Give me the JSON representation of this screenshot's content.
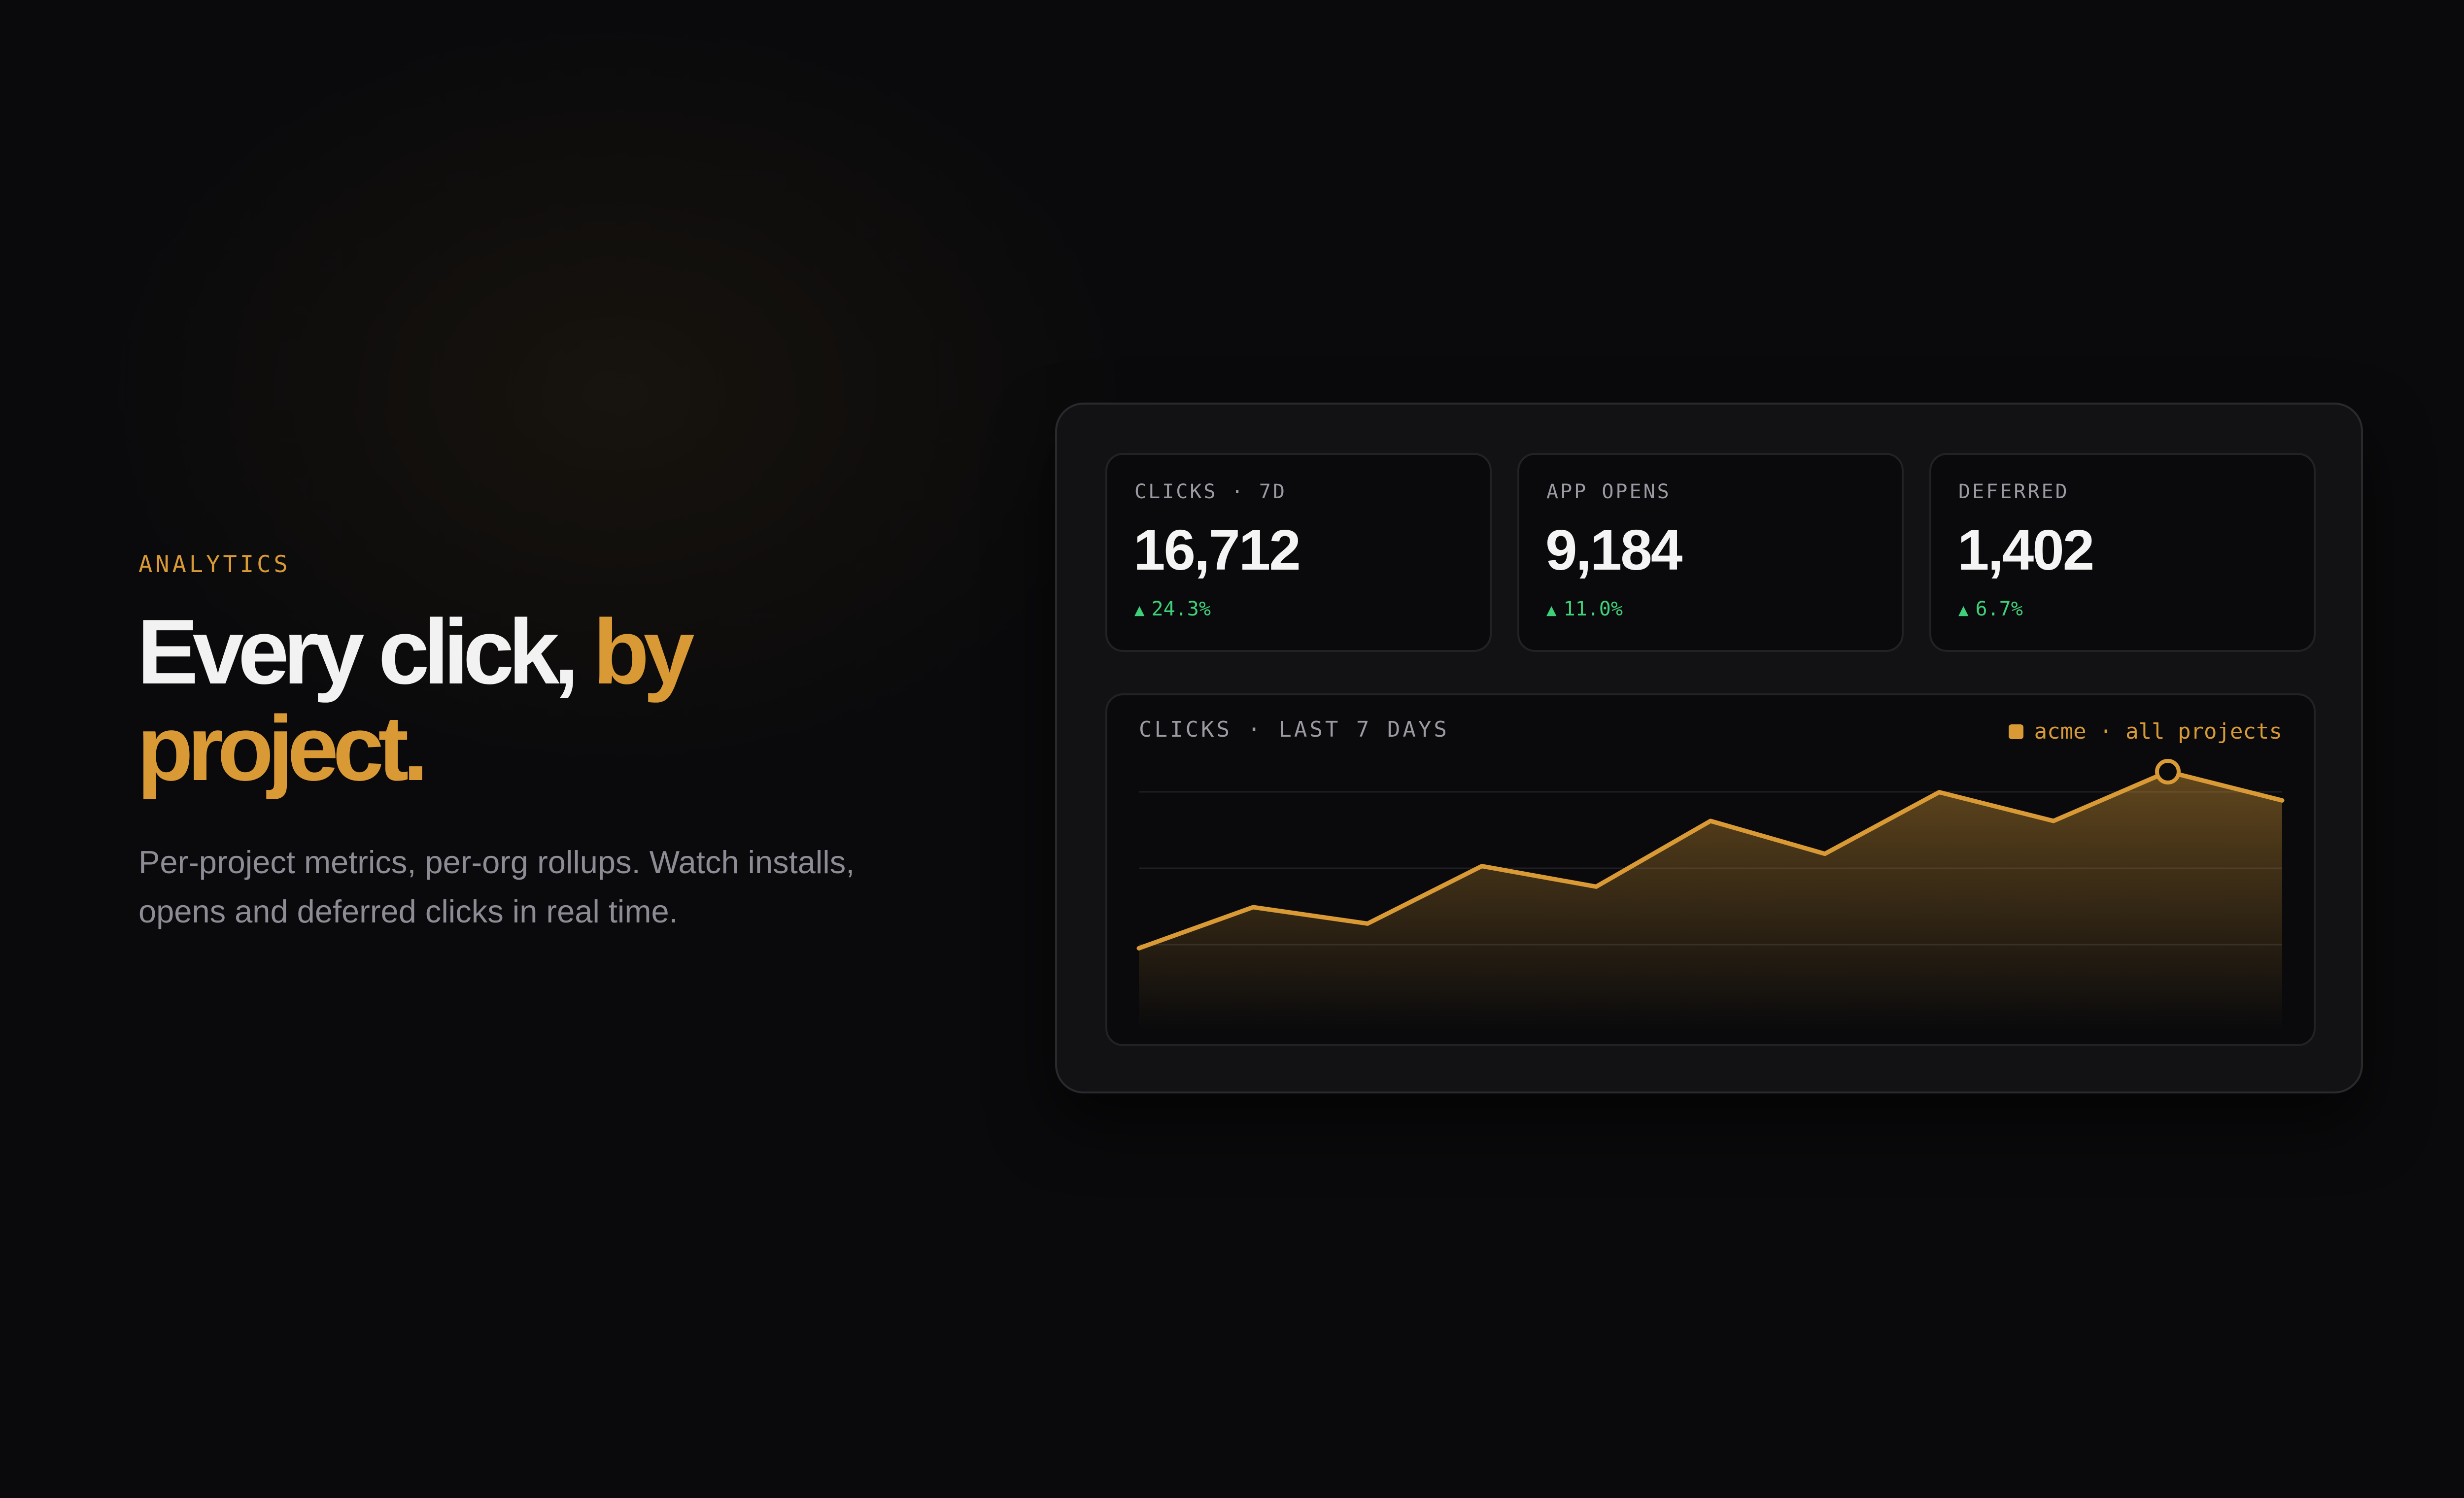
{
  "hero": {
    "eyebrow": "ANALYTICS",
    "headline_main": "Every click,",
    "headline_accent": "by project.",
    "subtitle": "Per-project metrics, per-org rollups. Watch installs, opens and deferred clicks in real time."
  },
  "stats": [
    {
      "label": "CLICKS · 7D",
      "value": "16,712",
      "delta": "24.3%",
      "trend_icon": "triangle-up-icon"
    },
    {
      "label": "APP OPENS",
      "value": "9,184",
      "delta": "11.0%",
      "trend_icon": "triangle-up-icon"
    },
    {
      "label": "DEFERRED",
      "value": "1,402",
      "delta": "6.7%",
      "trend_icon": "triangle-up-icon"
    }
  ],
  "chart_legend": "acme · all projects",
  "colors": {
    "accent": "#d99a35",
    "positive": "#3fd07a",
    "background": "#0a0a0c",
    "panel": "#121214"
  },
  "chart_data": {
    "type": "area",
    "title": "CLICKS · LAST 7 DAYS",
    "series": [
      {
        "name": "acme · all projects",
        "values": [
          1.0,
          1.5,
          1.3,
          2.0,
          1.75,
          2.55,
          2.15,
          2.9,
          2.55,
          3.15,
          2.8
        ]
      }
    ],
    "highlight_index": 9,
    "ylim": [
      0,
      3.3
    ],
    "grid": true,
    "grid_lines": 3,
    "legend_position": "top-right"
  }
}
